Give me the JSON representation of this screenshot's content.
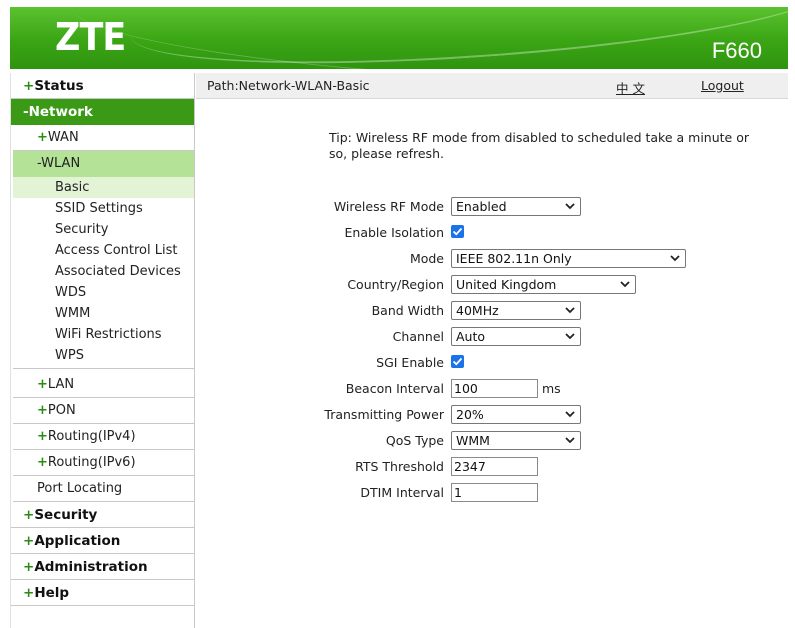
{
  "header": {
    "logo": "ZTE",
    "model": "F660"
  },
  "sidebar": {
    "status": "Status",
    "network": "-Network",
    "wan": "WAN",
    "wlan": "-WLAN",
    "wlan_items": [
      "Basic",
      "SSID Settings",
      "Security",
      "Access Control List",
      "Associated Devices",
      "WDS",
      "WMM",
      "WiFi Restrictions",
      "WPS"
    ],
    "lan": "LAN",
    "pon": "PON",
    "routing_v4": "Routing(IPv4)",
    "routing_v6": "Routing(IPv6)",
    "port_locating": "Port Locating",
    "security": "Security",
    "application": "Application",
    "administration": "Administration",
    "help": "Help"
  },
  "topbar": {
    "path": "Path:Network-WLAN-Basic",
    "language": "中 文",
    "logout": "Logout"
  },
  "tip": "Tip: Wireless RF mode from disabled to scheduled take a minute or so, please refresh.",
  "form": {
    "rf_mode": {
      "label": "Wireless RF Mode",
      "value": "Enabled"
    },
    "isolation": {
      "label": "Enable Isolation",
      "checked": true
    },
    "mode": {
      "label": "Mode",
      "value": "IEEE 802.11n Only"
    },
    "country": {
      "label": "Country/Region",
      "value": "United Kingdom"
    },
    "bandwidth": {
      "label": "Band Width",
      "value": "40MHz"
    },
    "channel": {
      "label": "Channel",
      "value": "Auto"
    },
    "sgi": {
      "label": "SGI Enable",
      "checked": true
    },
    "beacon": {
      "label": "Beacon Interval",
      "value": "100",
      "unit": "ms"
    },
    "tx_power": {
      "label": "Transmitting Power",
      "value": "20%"
    },
    "qos": {
      "label": "QoS Type",
      "value": "WMM"
    },
    "rts": {
      "label": "RTS Threshold",
      "value": "2347"
    },
    "dtim": {
      "label": "DTIM Interval",
      "value": "1"
    }
  },
  "colors": {
    "brand_green": "#3aa514",
    "active_nav": "#3a9a16",
    "active_sub": "#b4e397",
    "active_leaf": "#e3f4d6",
    "checkbox": "#1a73e8"
  }
}
